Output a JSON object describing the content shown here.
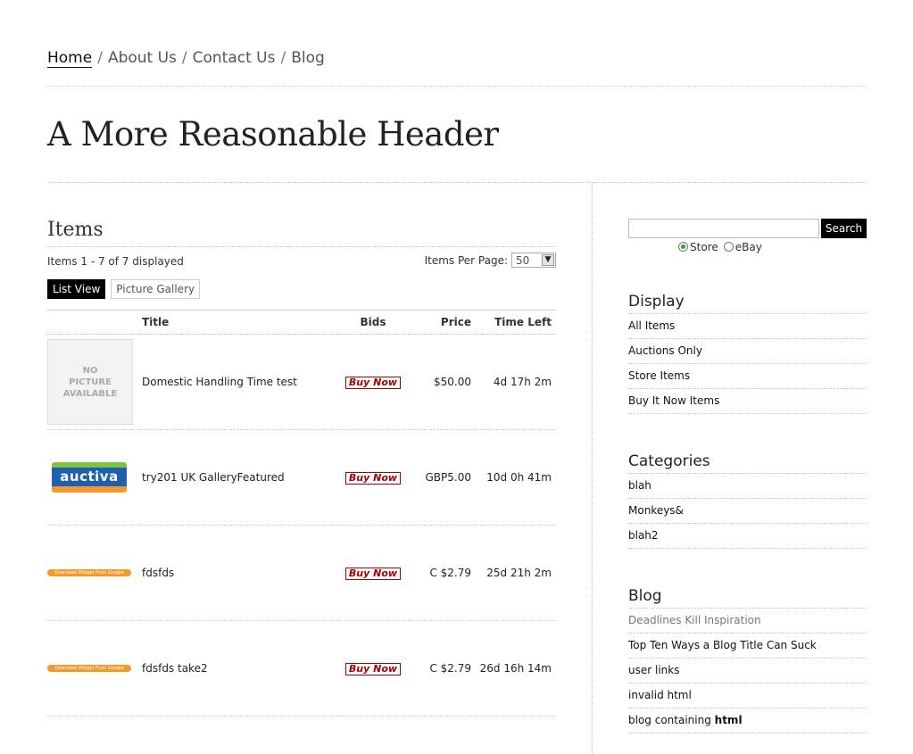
{
  "nav": {
    "items": [
      "Home",
      "About Us",
      "Contact Us",
      "Blog"
    ],
    "separator": "/"
  },
  "site_title": "A More Reasonable Header",
  "main": {
    "heading": "Items",
    "summary": "Items 1 - 7 of 7 displayed",
    "items_per_page_label": "Items Per Page:",
    "items_per_page_value": "50",
    "views": [
      "List View",
      "Picture Gallery"
    ],
    "table": {
      "headers": [
        "",
        "Title",
        "Bids",
        "Price",
        "Time Left"
      ],
      "rows": [
        {
          "thumb": "no-picture",
          "thumb_text": [
            "NO",
            "PICTURE",
            "AVAILABLE"
          ],
          "title": "Domestic Handling Time test",
          "bids": "Buy Now",
          "price": "$50.00",
          "time_left": "4d 17h 2m"
        },
        {
          "thumb": "auctiva-logo",
          "thumb_text": [
            "auctiva"
          ],
          "title": "try201 UK GalleryFeatured",
          "bids": "Buy Now",
          "price": "GBP5.00",
          "time_left": "10d 0h 41m"
        },
        {
          "thumb": "widget-banner",
          "thumb_text": [
            "Download Widget From Google"
          ],
          "title": "fdsfds",
          "bids": "Buy Now",
          "price": "C $2.79",
          "time_left": "25d 21h 2m"
        },
        {
          "thumb": "widget-banner",
          "thumb_text": [
            "Download Widget From Google"
          ],
          "title": "fdsfds take2",
          "bids": "Buy Now",
          "price": "C $2.79",
          "time_left": "26d 16h 14m"
        }
      ]
    }
  },
  "sidebar": {
    "search": {
      "placeholder": "",
      "button": "Search",
      "options": [
        "Store",
        "eBay"
      ],
      "selected": "Store"
    },
    "display": {
      "title": "Display",
      "items": [
        "All Items",
        "Auctions Only",
        "Store Items",
        "Buy It Now Items"
      ]
    },
    "categories": {
      "title": "Categories",
      "items": [
        "blah",
        "Monkeys&",
        "blah2"
      ]
    },
    "blog": {
      "title": "Blog",
      "items": [
        "Deadlines Kill Inspiration",
        "Top Ten Ways a Blog Title Can Suck",
        "user links",
        "invalid html",
        "blog containing"
      ],
      "last_item_bold": "html"
    }
  },
  "colors": {
    "accent": "#000000",
    "buy_now": "#aa0000",
    "auctiva_green": "#7ec242",
    "auctiva_blue": "#1f5fb0",
    "auctiva_orange": "#f39a2a"
  }
}
